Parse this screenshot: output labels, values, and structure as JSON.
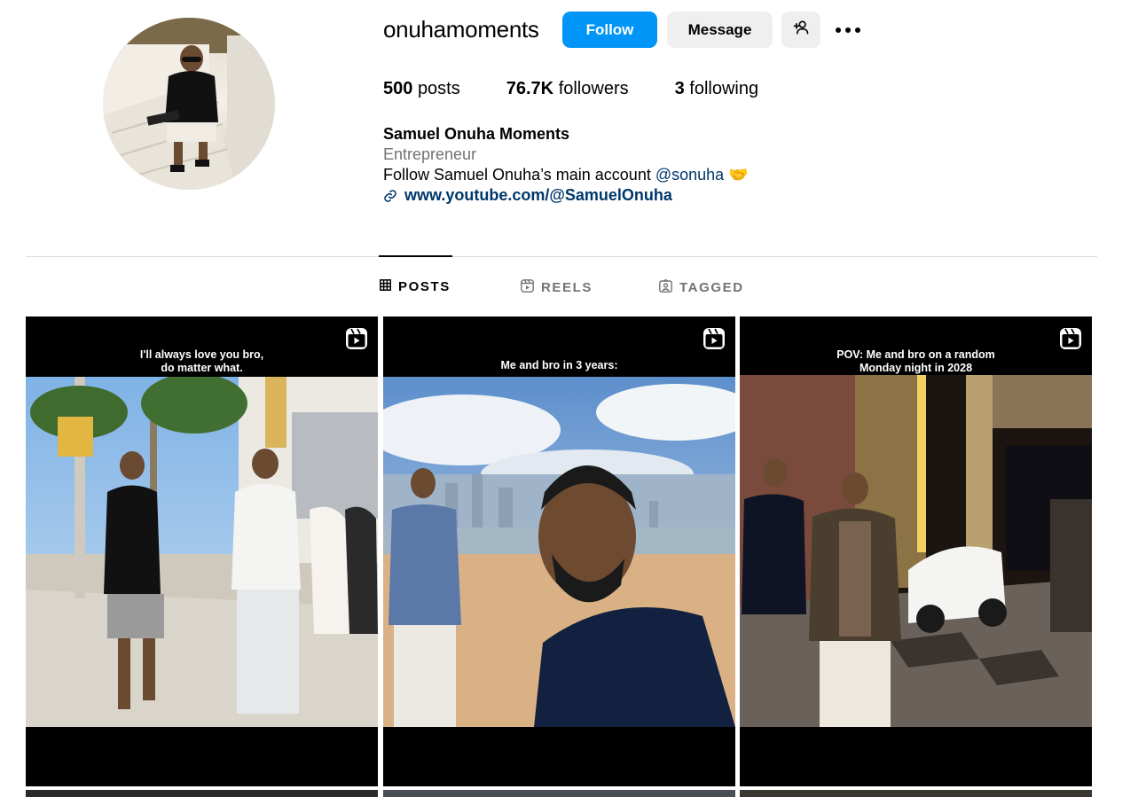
{
  "profile": {
    "username": "onuhamoments",
    "follow_label": "Follow",
    "message_label": "Message",
    "add_user_icon": "person-plus-icon",
    "more_icon": "more-icon"
  },
  "stats": {
    "posts_count": "500",
    "posts_label": "posts",
    "followers_count": "76.7K",
    "followers_label": "followers",
    "following_count": "3",
    "following_label": "following"
  },
  "bio": {
    "name": "Samuel Onuha Moments",
    "category": "Entrepreneur",
    "text": "Follow Samuel Onuha’s main account ",
    "mention": "@sonuha",
    "emoji": "🤝",
    "link": "www.youtube.com/@SamuelOnuha"
  },
  "tabs": [
    {
      "label": "POSTS",
      "icon": "grid-icon",
      "active": true
    },
    {
      "label": "REELS",
      "icon": "reels-icon",
      "active": false
    },
    {
      "label": "TAGGED",
      "icon": "tagged-icon",
      "active": false
    }
  ],
  "posts": [
    {
      "caption_line1": "I'll always love you bro,",
      "caption_line2": "do matter what.",
      "type": "reel"
    },
    {
      "caption_line1": "Me and bro in 3 years:",
      "caption_line2": "",
      "type": "reel"
    },
    {
      "caption_line1": "POV: Me and bro on a random",
      "caption_line2": "Monday night in 2028",
      "type": "reel"
    }
  ],
  "colors": {
    "accent": "#0095f6",
    "link": "#00376b",
    "secondary_text": "#737373",
    "divider": "#dbdbdb"
  }
}
